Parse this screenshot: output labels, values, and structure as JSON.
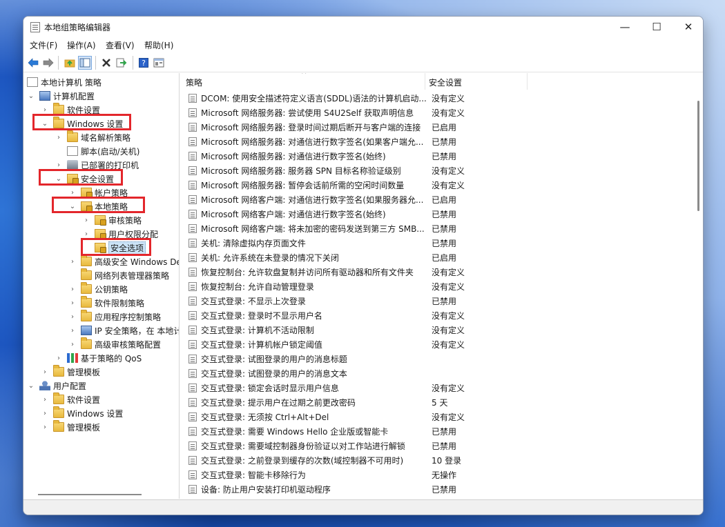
{
  "window": {
    "title": "本地组策略编辑器",
    "controls": {
      "minimize": "—",
      "maximize": "☐",
      "close": "✕"
    }
  },
  "menubar": {
    "file": "文件(F)",
    "action": "操作(A)",
    "view": "查看(V)",
    "help": "帮助(H)"
  },
  "toolbar": {
    "icons": [
      "back-icon",
      "forward-icon",
      "up-folder-icon",
      "show-hide-tree-icon",
      "delete-icon",
      "export-list-icon",
      "help-icon",
      "properties-icon"
    ]
  },
  "tree": {
    "root": "本地计算机 策略",
    "computer_config": "计算机配置",
    "software_settings": "软件设置",
    "windows_settings": "Windows 设置",
    "name_resolution": "域名解析策略",
    "scripts": "脚本(启动/关机)",
    "printers": "已部署的打印机",
    "security_settings": "安全设置",
    "account_policies": "帐户策略",
    "local_policies": "本地策略",
    "audit_policy": "审核策略",
    "user_rights": "用户权限分配",
    "security_options": "安全选项",
    "advanced_firewall": "高级安全 Windows De",
    "network_list": "网络列表管理器策略",
    "public_key": "公钥策略",
    "software_restriction": "软件限制策略",
    "app_control": "应用程序控制策略",
    "ip_security": "IP 安全策略，在 本地计",
    "advanced_audit": "高级审核策略配置",
    "qos": "基于策略的 QoS",
    "admin_templates": "管理模板",
    "user_config": "用户配置",
    "user_software": "软件设置",
    "user_windows": "Windows 设置",
    "user_admin_templates": "管理模板"
  },
  "list": {
    "columns": {
      "policy": "策略",
      "setting": "安全设置"
    },
    "rows": [
      {
        "name": "DCOM: 使用安全描述符定义语言(SDDL)语法的计算机启动...",
        "value": "没有定义"
      },
      {
        "name": "Microsoft 网络服务器: 尝试使用 S4U2Self 获取声明信息",
        "value": "没有定义"
      },
      {
        "name": "Microsoft 网络服务器: 登录时间过期后断开与客户端的连接",
        "value": "已启用"
      },
      {
        "name": "Microsoft 网络服务器: 对通信进行数字签名(如果客户端允...",
        "value": "已禁用"
      },
      {
        "name": "Microsoft 网络服务器: 对通信进行数字签名(始终)",
        "value": "已禁用"
      },
      {
        "name": "Microsoft 网络服务器: 服务器 SPN 目标名称验证级别",
        "value": "没有定义"
      },
      {
        "name": "Microsoft 网络服务器: 暂停会话前所需的空闲时间数量",
        "value": "没有定义"
      },
      {
        "name": "Microsoft 网络客户端: 对通信进行数字签名(如果服务器允...",
        "value": "已启用"
      },
      {
        "name": "Microsoft 网络客户端: 对通信进行数字签名(始终)",
        "value": "已禁用"
      },
      {
        "name": "Microsoft 网络客户端: 将未加密的密码发送到第三方 SMB...",
        "value": "已禁用"
      },
      {
        "name": "关机: 清除虚拟内存页面文件",
        "value": "已禁用"
      },
      {
        "name": "关机: 允许系统在未登录的情况下关闭",
        "value": "已启用"
      },
      {
        "name": "恢复控制台: 允许软盘复制并访问所有驱动器和所有文件夹",
        "value": "没有定义"
      },
      {
        "name": "恢复控制台: 允许自动管理登录",
        "value": "没有定义"
      },
      {
        "name": "交互式登录: 不显示上次登录",
        "value": "已禁用"
      },
      {
        "name": "交互式登录: 登录时不显示用户名",
        "value": "没有定义"
      },
      {
        "name": "交互式登录: 计算机不活动限制",
        "value": "没有定义"
      },
      {
        "name": "交互式登录: 计算机帐户锁定阈值",
        "value": "没有定义"
      },
      {
        "name": "交互式登录: 试图登录的用户的消息标题",
        "value": ""
      },
      {
        "name": "交互式登录: 试图登录的用户的消息文本",
        "value": ""
      },
      {
        "name": "交互式登录: 锁定会话时显示用户信息",
        "value": "没有定义"
      },
      {
        "name": "交互式登录: 提示用户在过期之前更改密码",
        "value": "5 天"
      },
      {
        "name": "交互式登录: 无须按 Ctrl+Alt+Del",
        "value": "没有定义"
      },
      {
        "name": "交互式登录: 需要 Windows Hello 企业版或智能卡",
        "value": "已禁用"
      },
      {
        "name": "交互式登录: 需要域控制器身份验证以对工作站进行解锁",
        "value": "已禁用"
      },
      {
        "name": "交互式登录: 之前登录到缓存的次数(域控制器不可用时)",
        "value": "10 登录"
      },
      {
        "name": "交互式登录: 智能卡移除行为",
        "value": "无操作"
      },
      {
        "name": "设备: 防止用户安装打印机驱动程序",
        "value": "已禁用"
      }
    ]
  }
}
